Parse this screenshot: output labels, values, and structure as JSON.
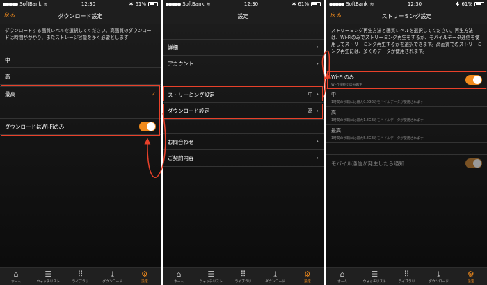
{
  "status_bar": {
    "carrier": "SoftBank",
    "time": "12:30",
    "battery": "61%"
  },
  "screen1": {
    "back": "戻る",
    "title": "ダウンロード設定",
    "description": "ダウンロードする画質レベルを選択してください。高画質のダウンロードは時間がかかり、またストレージ容量を多く必要とします",
    "options": [
      "中",
      "高",
      "最高"
    ],
    "selected": "最高",
    "wifi_only_label": "ダウンロードはWi-Fiのみ"
  },
  "screen2": {
    "title": "設定",
    "rows": [
      {
        "label": "詳細",
        "value": ""
      },
      {
        "label": "アカウント",
        "value": ""
      },
      {
        "label": "ストリーミング設定",
        "value": "中"
      },
      {
        "label": "ダウンロード設定",
        "value": "高"
      },
      {
        "label": "お問合わせ",
        "value": ""
      },
      {
        "label": "ご契約内容",
        "value": ""
      }
    ]
  },
  "screen3": {
    "back": "戻る",
    "title": "ストリーミング設定",
    "description": "ストリーミング再生方法と画質レベルを選択してください。再生方法は、Wi-Fiのみでストリーミング再生をするか、モバイルデータ通信を使用してストリーミング再生するかを選択できます。高画質でのストリーミング再生には、多くのデータが使用されます。",
    "wifi_option": {
      "title": "Wi-Fi のみ",
      "sub": "Wi-Fi接続でのみ再生"
    },
    "options": [
      {
        "title": "中",
        "sub": "1時間の視聴には最大0.6GBのモバイルデータが使用されます"
      },
      {
        "title": "高",
        "sub": "1時間の視聴には最大1.8GBのモバイルデータが使用されます"
      },
      {
        "title": "最高",
        "sub": "1時間の視聴には最大5.8GBのモバイルデータが使用されます"
      }
    ],
    "notify_label": "モバイル通信が発生したら通知"
  },
  "tabbar": {
    "items": [
      {
        "label": "ホーム",
        "icon": "home-icon"
      },
      {
        "label": "ウォッチリスト",
        "icon": "list-icon"
      },
      {
        "label": "ライブラリ",
        "icon": "grid-icon"
      },
      {
        "label": "ダウンロード",
        "icon": "download-icon"
      },
      {
        "label": "設定",
        "icon": "gear-icon"
      }
    ]
  },
  "colors": {
    "accent": "#f08a1c",
    "highlight": "#e8412a",
    "background": "#141414"
  }
}
